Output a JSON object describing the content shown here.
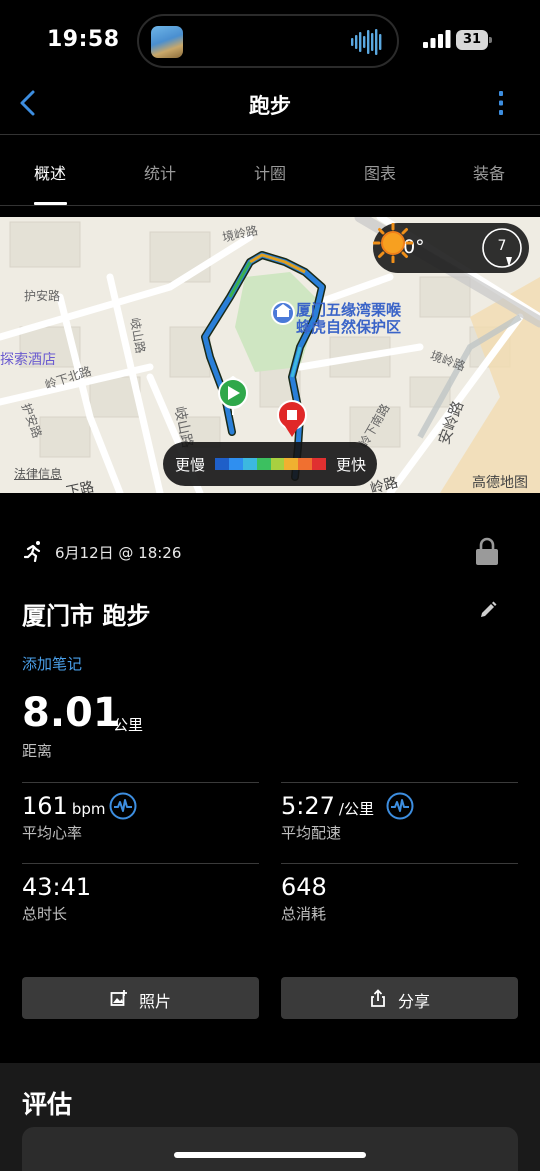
{
  "status_bar": {
    "time": "19:58",
    "battery": "31"
  },
  "nav": {
    "title": "跑步"
  },
  "tabs": [
    {
      "label": "概述",
      "active": true
    },
    {
      "label": "统计",
      "active": false
    },
    {
      "label": "计圈",
      "active": false
    },
    {
      "label": "图表",
      "active": false
    },
    {
      "label": "装备",
      "active": false
    }
  ],
  "map": {
    "weather": {
      "temperature": "30°",
      "icon": "sun-icon",
      "wind": "7"
    },
    "legend": {
      "slow": "更慢",
      "fast": "更快",
      "colors": [
        "#1f5fc8",
        "#2f8ff0",
        "#3cb8e0",
        "#3cc060",
        "#a8d040",
        "#f0b030",
        "#f07030",
        "#e03030"
      ]
    },
    "labels": {
      "park": "厦门五缘湾栗喉",
      "park2": "蜂虎自然保护区",
      "hotel": "探索酒店",
      "road_huan": "护安路",
      "road_qishan": "岐山路",
      "road_lingxia": "岭下北路",
      "road_huan2": "护安路",
      "road_anling": "安岭路",
      "road_jingling": "境岭路",
      "road_jingling2": "境岭路",
      "road_lingxia2": "岭下南路",
      "road_qishan2": "岐山路",
      "road_xia": "下路",
      "road_ling": "岭路",
      "legal": "法律信息",
      "amap": "高德地图"
    }
  },
  "activity": {
    "date": "6月12日 @ 18:26",
    "title": "厦门市 跑步",
    "add_note": "添加笔记",
    "distance": {
      "value": "8.01",
      "unit": "公里",
      "label": "距离"
    },
    "stats": {
      "heart_rate": {
        "value": "161",
        "unit": "bpm",
        "label": "平均心率"
      },
      "pace": {
        "value": "5:27",
        "unit": "/公里",
        "label": "平均配速"
      },
      "duration": {
        "value": "43:41",
        "label": "总时长"
      },
      "calories": {
        "value": "648",
        "label": "总消耗"
      }
    },
    "buttons": {
      "photo": "照片",
      "share": "分享"
    }
  },
  "evaluation": {
    "title": "评估"
  },
  "colors": {
    "accent": "#4a9fe8",
    "background": "#000000",
    "button": "#3a3a3a"
  }
}
